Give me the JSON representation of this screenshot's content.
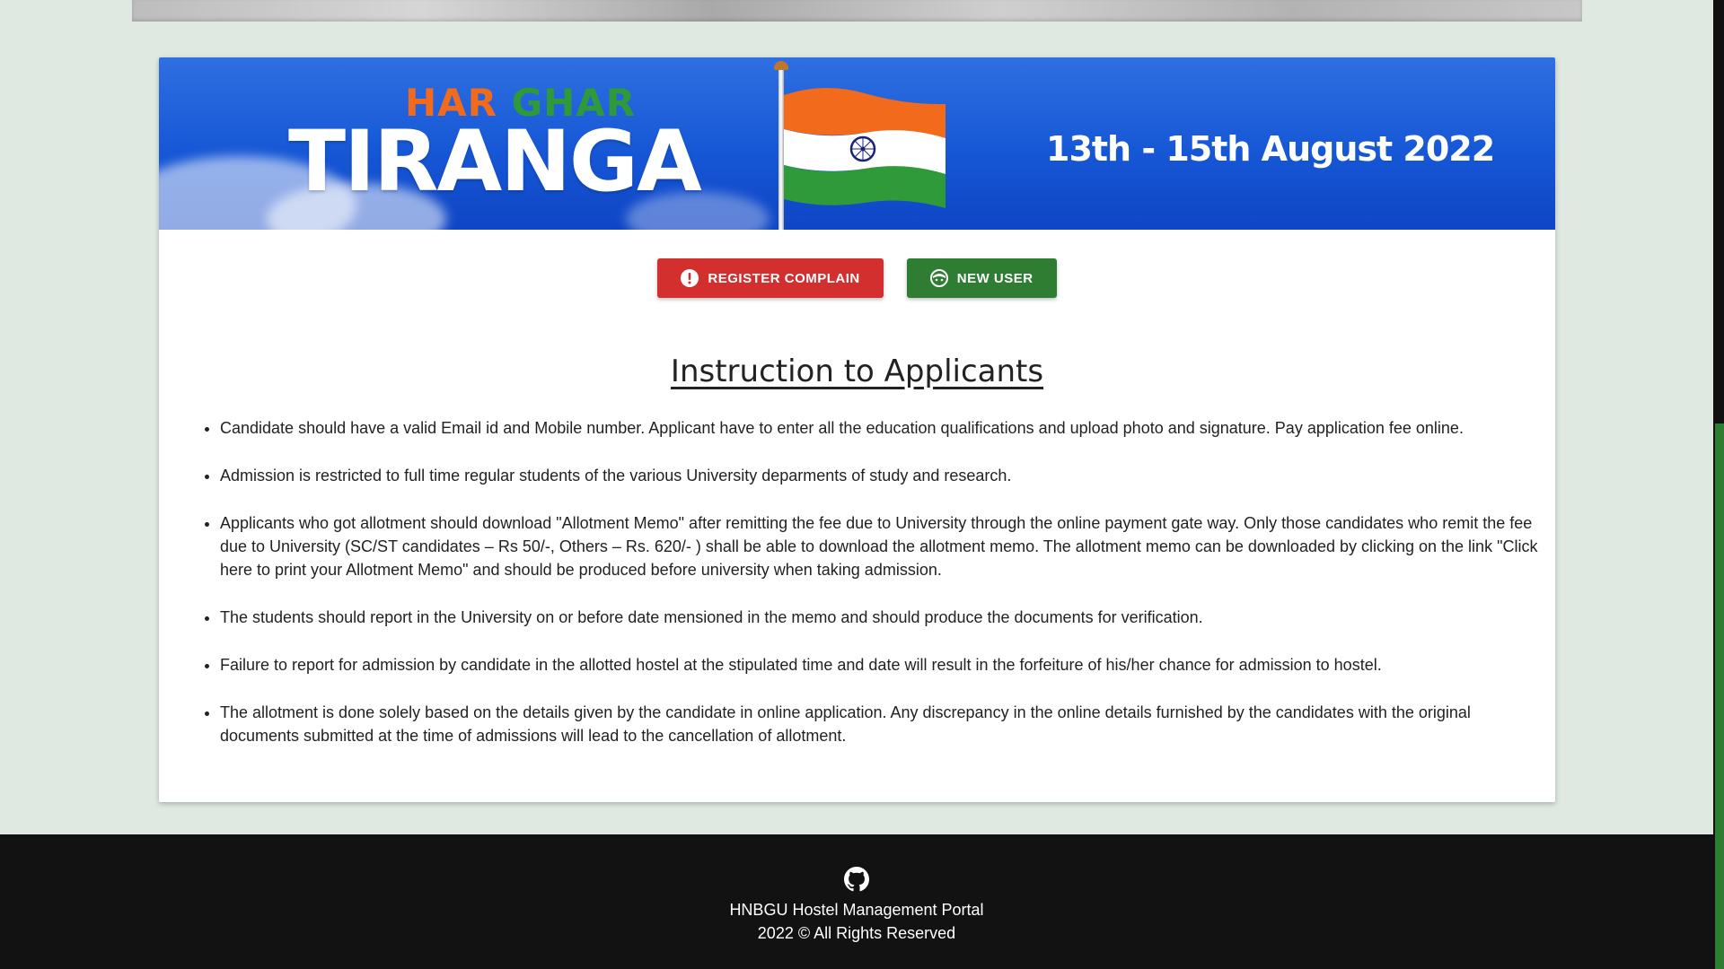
{
  "banner": {
    "line_top_part1": "HAR",
    "line_top_part2": "GHAR",
    "line_main": "TIRANGA",
    "date": "13th - 15th August 2022"
  },
  "buttons": {
    "register_label": "REGISTER COMPLAIN",
    "new_user_label": "NEW USER"
  },
  "instructions": {
    "title": "Instruction to Applicants",
    "items": [
      "Candidate should have a valid Email id and Mobile number. Applicant have to enter all the education qualifications and upload photo and signature. Pay application fee online.",
      "Admission is restricted to full time regular students of the various University deparments of study and research.",
      "Applicants who got allotment should download \"Allotment Memo\" after remitting the fee due to University through the online payment gate way. Only those candidates who remit the fee due to University (SC/ST candidates – Rs 50/-, Others – Rs. 620/- ) shall be able to download the allotment memo. The allotment memo can be downloaded by clicking on the link \"Click here to print your Allotment Memo\" and should be produced before university when taking admission.",
      "The students should report in the University on or before date mensioned in the memo and should produce the documents for verification.",
      "Failure to report for admission by candidate in the allotted hostel at the stipulated time and date will result in the forfeiture of his/her chance for admission to hostel.",
      "The allotment is done solely based on the details given by the candidate in online application. Any discrepancy in the online details furnished by the candidates with the original documents submitted at the time of admissions will lead to the cancellation of allotment."
    ]
  },
  "footer": {
    "icon": "github-icon",
    "portal_name": "HNBGU Hostel Management Portal",
    "copyright": "2022 © All Rights Reserved"
  },
  "colors": {
    "page_bg": "#dfe9e1",
    "register_button": "#d32f2f",
    "new_user_button": "#2e7d32",
    "footer_bg": "#121212",
    "banner_blue": "#1657d6",
    "saffron": "#f26b1d",
    "flag_green": "#2f9a3a"
  }
}
